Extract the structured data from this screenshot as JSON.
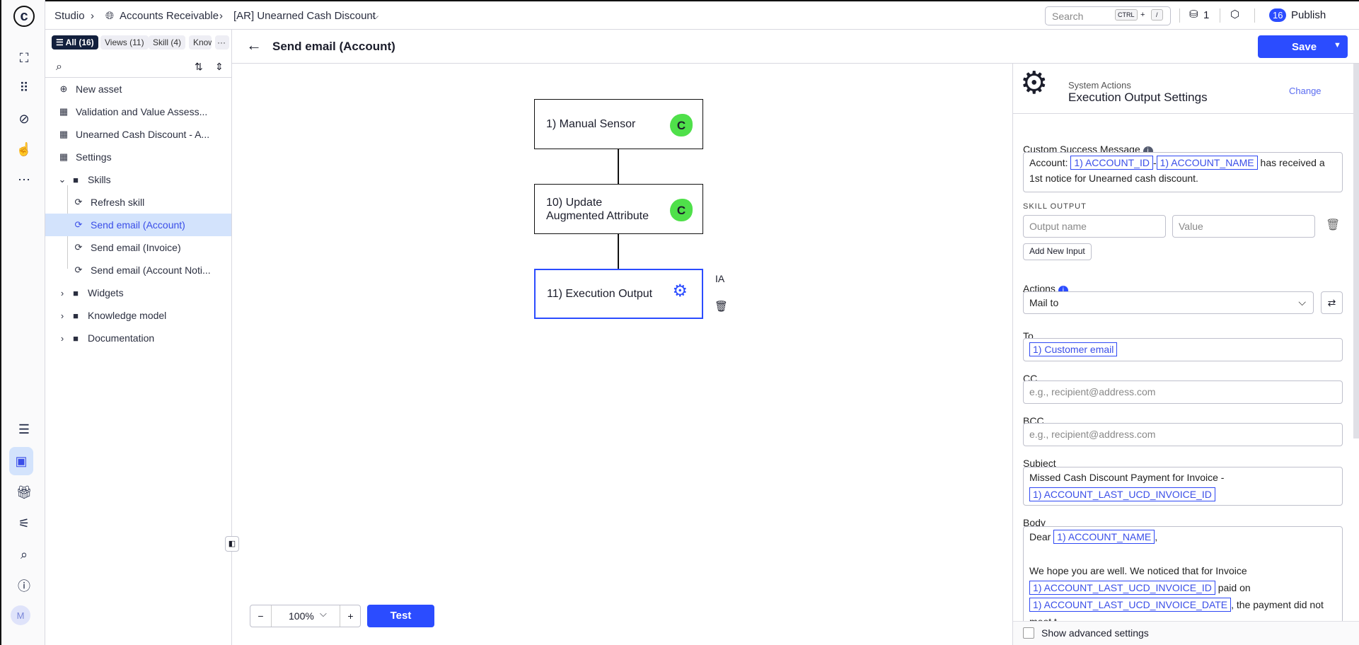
{
  "breadcrumb": {
    "root": "Studio",
    "project": "Accounts Receivable",
    "asset": "[AR] Unearned Cash Discount"
  },
  "topbar": {
    "search_placeholder": "Search",
    "shortcut_key1": "CTRL",
    "shortcut_plus": "+",
    "shortcut_key2": "/",
    "db_count": "1",
    "publish_count": "16",
    "publish_label": "Publish"
  },
  "sidebar": {
    "filters": [
      {
        "label": "All (16)"
      },
      {
        "label": "Views (11)"
      },
      {
        "label": "Skill (4)"
      },
      {
        "label": "Know"
      }
    ],
    "more": "···",
    "new_asset": "New asset",
    "items": [
      {
        "label": "Validation and Value Assess..."
      },
      {
        "label": "Unearned Cash Discount - A..."
      },
      {
        "label": "Settings"
      },
      {
        "label": "Skills"
      },
      {
        "label": "Refresh skill"
      },
      {
        "label": "Send email (Account)"
      },
      {
        "label": "Send email (Invoice)"
      },
      {
        "label": "Send email (Account Noti..."
      },
      {
        "label": "Widgets"
      },
      {
        "label": "Knowledge model"
      },
      {
        "label": "Documentation"
      }
    ]
  },
  "rail": {
    "avatar": "M"
  },
  "header": {
    "title": "Send email (Account)",
    "save": "Save"
  },
  "canvas": {
    "nodes": [
      {
        "label": "1) Manual Sensor",
        "badge": "C"
      },
      {
        "label": "10) Update Augmented Attribute",
        "badge": "C"
      },
      {
        "label": "11) Execution Output"
      }
    ],
    "rename_icon": "IA",
    "zoom": "100%",
    "zoom_out": "−",
    "zoom_in": "+",
    "test": "Test"
  },
  "panel": {
    "category": "System Actions",
    "title": "Execution Output Settings",
    "change": "Change",
    "success_label": "Custom Success Message",
    "success": {
      "prefix": "Account:",
      "tok1": "1) ACCOUNT_ID",
      "sep": "-",
      "tok2": "1) ACCOUNT_NAME",
      "suffix": "has received a 1st notice for Unearned cash discount."
    },
    "skill_output": "SKILL OUTPUT",
    "output_name_ph": "Output name",
    "value_ph": "Value",
    "add_input": "Add New Input",
    "actions_label": "Actions",
    "action_value": "Mail to",
    "to_label": "To",
    "to_token": "1) Customer email",
    "cc_label": "CC",
    "cc_ph": "e.g., recipient@address.com",
    "bcc_label": "BCC",
    "bcc_ph": "e.g., recipient@address.com",
    "subject_label": "Subject",
    "subject_text": "Missed Cash Discount Payment for Invoice -",
    "subject_token": "1) ACCOUNT_LAST_UCD_INVOICE_ID",
    "body_label": "Body",
    "body": {
      "dear": "Dear",
      "tok_name": "1) ACCOUNT_NAME",
      "comma": ",",
      "line2": "We hope you are well. We noticed that for Invoice",
      "tok_id": "1) ACCOUNT_LAST_UCD_INVOICE_ID",
      "paid_on": "paid on",
      "tok_date": "1) ACCOUNT_LAST_UCD_INVOICE_DATE",
      "line4": ", the payment did not meet t"
    },
    "advanced": "Show advanced settings"
  },
  "colors": {
    "accent": "#2b4cff",
    "selected_bg": "#d3e3fc",
    "badge_green": "#4fe04a"
  }
}
